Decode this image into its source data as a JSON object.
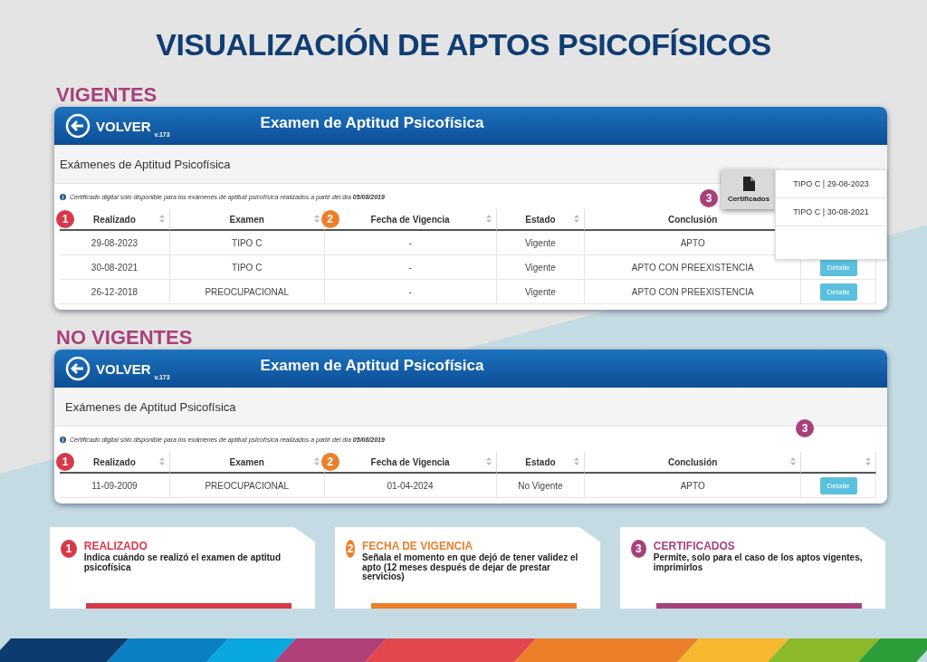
{
  "title": "VISUALIZACIÓN DE APTOS PSICOFÍSICOS",
  "sections": [
    {
      "heading": "VIGENTES",
      "screen": {
        "back_label": "VOLVER",
        "version": "v.173",
        "app_title": "Examen de Aptitud Psicofísica",
        "page_title": "Exámenes de Aptitud Psicofísica",
        "notice": "Certificado digital sólo disponible para los exámenes de aptitud psicofísica realizados a partir del día **05/08/2019**",
        "columns": [
          {
            "label": "Realizado",
            "marker": {
              "number": "1",
              "color": "#d9384a"
            }
          },
          {
            "label": "Examen"
          },
          {
            "label": "Fecha de Vigencia",
            "marker": {
              "number": "2",
              "color": "#ec7f2a"
            }
          },
          {
            "label": "Estado"
          },
          {
            "label": "Conclusión"
          }
        ],
        "rows": [
          {
            "cells": [
              "29-08-2023",
              "TIPO C",
              "-",
              "Vigente",
              "APTO"
            ]
          },
          {
            "cells": [
              "30-08-2021",
              "TIPO C",
              "-",
              "Vigente",
              "APTO CON PREEXISTENCIA"
            ],
            "action": "Detalle"
          },
          {
            "cells": [
              "26-12-2018",
              "PREOCUPACIONAL",
              "-",
              "Vigente",
              "APTO CON PREEXISTENCIA"
            ],
            "action": "Detalle"
          }
        ],
        "certificates": {
          "button": "Certificados",
          "marker": {
            "number": "3",
            "color": "#a8407a"
          },
          "items": [
            "TIPO C | 29-08-2023",
            "TIPO C | 30-08-2021"
          ]
        }
      }
    },
    {
      "heading": "NO VIGENTES",
      "screen": {
        "back_label": "VOLVER",
        "version": "v.173",
        "app_title": "Examen de Aptitud Psicofísica",
        "page_title": "Exámenes de Aptitud Psicofísica",
        "notice": "Certificado digital sólo disponible para los exámenes de aptitud psicofísica realizados a partir del día **05/08/2019**",
        "columns": [
          {
            "label": "Realizado",
            "marker": {
              "number": "1",
              "color": "#d9384a"
            }
          },
          {
            "label": "Examen"
          },
          {
            "label": "Fecha de Vigencia",
            "marker": {
              "number": "2",
              "color": "#ec7f2a"
            }
          },
          {
            "label": "Estado"
          },
          {
            "label": "Conclusión"
          }
        ],
        "rows": [
          {
            "cells": [
              "11-09-2009",
              "PREOCUPACIONAL",
              "01-04-2024",
              "No Vigente",
              "APTO"
            ],
            "action": "Detalle"
          }
        ],
        "certificates": {
          "marker": {
            "number": "3",
            "color": "#a8407a"
          }
        }
      }
    }
  ],
  "legend": [
    {
      "number": "1",
      "title": "REALIZADO",
      "text": "Indica cuándo se realizó el examen de aptitud psicofísica",
      "color": "#d9384a"
    },
    {
      "number": "2",
      "title": "FECHA DE VIGENCIA",
      "text": "Señala el momento en que dejó de tener validez el apto (12 meses después de dejar de prestar servicios)",
      "color": "#ec7f2a"
    },
    {
      "number": "3",
      "title": "CERTIFICADOS",
      "text": "Permite, solo para el caso de los aptos vigentes, imprimirlos",
      "color": "#a8407a"
    }
  ]
}
